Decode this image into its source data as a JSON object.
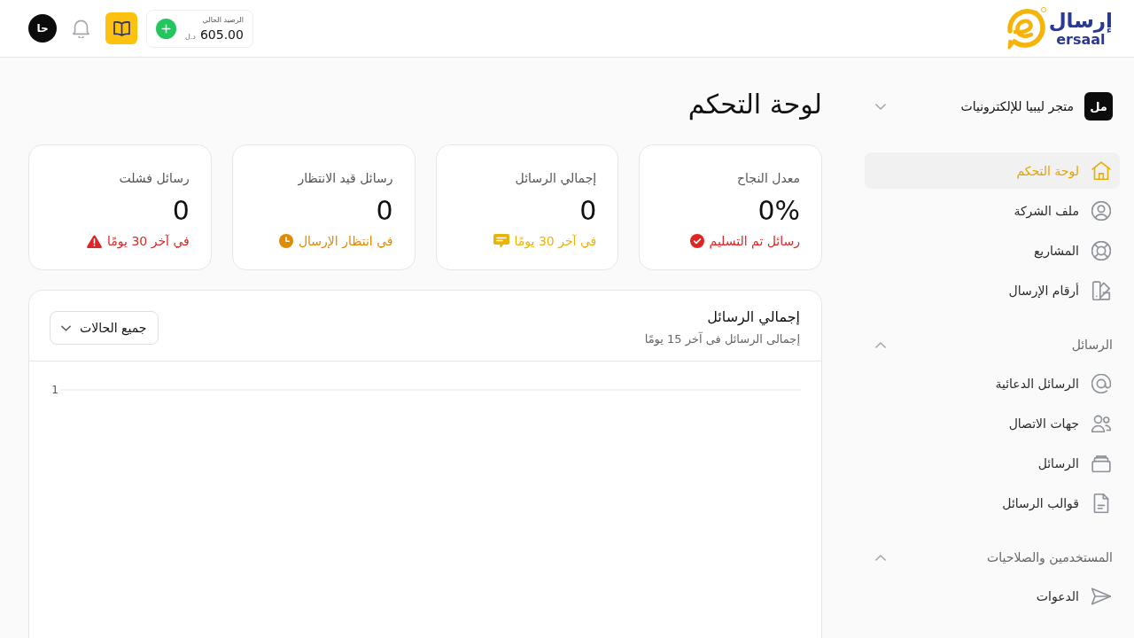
{
  "header": {
    "logo": {
      "arabic": "إرسال",
      "latin": "ersaal"
    },
    "balance": {
      "label": "الرصيد الحالي",
      "amount": "605.00",
      "currency": "د.ل"
    },
    "avatar": "حا"
  },
  "sidebar": {
    "workspace": {
      "initials": "مل",
      "name": "متجر ليبيا للإلكترونيات"
    },
    "groups": [
      {
        "items": [
          {
            "label": "لوحة التحكم",
            "selected": true
          },
          {
            "label": "ملف الشركة",
            "selected": false
          },
          {
            "label": "المشاريع",
            "selected": false
          },
          {
            "label": "أرقام الإرسال",
            "selected": false
          }
        ]
      },
      {
        "title": "الرسائل",
        "expanded": true,
        "items": [
          {
            "label": "الرسائل الدعائية",
            "selected": false
          },
          {
            "label": "جهات الاتصال",
            "selected": false
          },
          {
            "label": "الرسائل",
            "selected": false
          },
          {
            "label": "قوالب الرسائل",
            "selected": false
          }
        ]
      },
      {
        "title": "المستخدمين والصلاحيات",
        "expanded": true,
        "items": [
          {
            "label": "الدعوات",
            "selected": false
          }
        ]
      }
    ]
  },
  "page": {
    "title": "لوحة التحكم"
  },
  "stats": [
    {
      "title": "معدل النجاح",
      "value": "0%",
      "note": "رسائل تم التسليم",
      "kind": "success",
      "color": "#e02424"
    },
    {
      "title": "إجمالي الرسائل",
      "value": "0",
      "note": "في آخر 30 يومًا",
      "kind": "total",
      "color": "#eab308"
    },
    {
      "title": "رسائل قيد الانتظار",
      "value": "0",
      "note": "في انتظار الإرسال",
      "kind": "pending",
      "color": "#e08a00"
    },
    {
      "title": "رسائل فشلت",
      "value": "0",
      "note": "في آخر 30 يومًا",
      "kind": "failed",
      "color": "#e02424"
    }
  ],
  "messages_panel": {
    "title": "إجمالي الرسائل",
    "subtitle": "إجمالى الرسائل فى آخر 15 يومًا",
    "filter": "جميع الحالات",
    "chart": {
      "y_axis_labels": [
        "1"
      ]
    }
  }
}
